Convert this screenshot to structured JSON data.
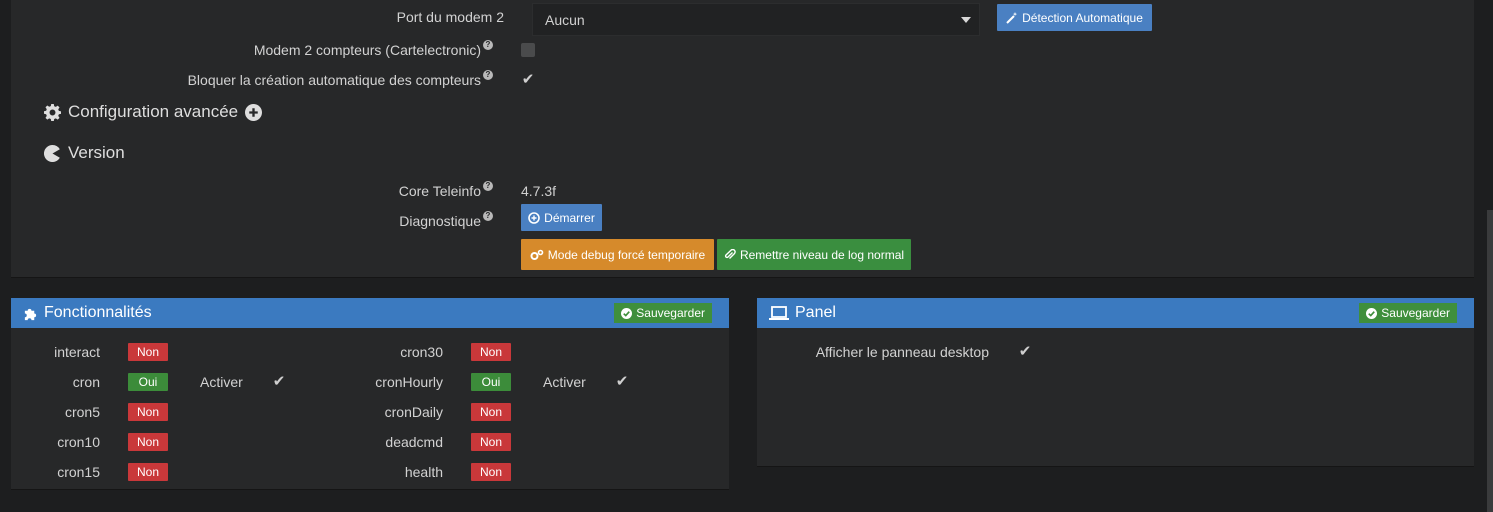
{
  "config": {
    "port_modem2_label": "Port du modem 2",
    "port_modem2_value": "Aucun",
    "detect_button": "Détection Automatique",
    "modem2_compteurs_label": "Modem 2 compteurs (Cartelectronic)",
    "modem2_compteurs_checked": false,
    "bloquer_label": "Bloquer la création automatique des compteurs",
    "bloquer_checked": true,
    "advanced_title": "Configuration avancée",
    "version_title": "Version",
    "core_label": "Core Teleinfo",
    "core_value": "4.7.3f",
    "diag_label": "Diagnostique",
    "demarrer_button": "Démarrer",
    "debug_button": "Mode debug forcé temporaire",
    "log_button": "Remettre niveau de log normal"
  },
  "fonctionnalites": {
    "title": "Fonctionnalités",
    "save_label": "Sauvegarder",
    "activer_label": "Activer",
    "left": [
      {
        "name": "interact",
        "status": "Non"
      },
      {
        "name": "cron",
        "status": "Oui",
        "activer": true
      },
      {
        "name": "cron5",
        "status": "Non"
      },
      {
        "name": "cron10",
        "status": "Non"
      },
      {
        "name": "cron15",
        "status": "Non"
      }
    ],
    "right": [
      {
        "name": "cron30",
        "status": "Non"
      },
      {
        "name": "cronHourly",
        "status": "Oui",
        "activer": true
      },
      {
        "name": "cronDaily",
        "status": "Non"
      },
      {
        "name": "deadcmd",
        "status": "Non"
      },
      {
        "name": "health",
        "status": "Non"
      }
    ]
  },
  "panel": {
    "title": "Panel",
    "save_label": "Sauvegarder",
    "desktop_label": "Afficher le panneau desktop",
    "desktop_checked": true
  },
  "colors": {
    "header_blue": "#3b7ac0",
    "non_red": "#c9383a",
    "oui_green": "#3c8c3a",
    "orange": "#d68a2b"
  }
}
